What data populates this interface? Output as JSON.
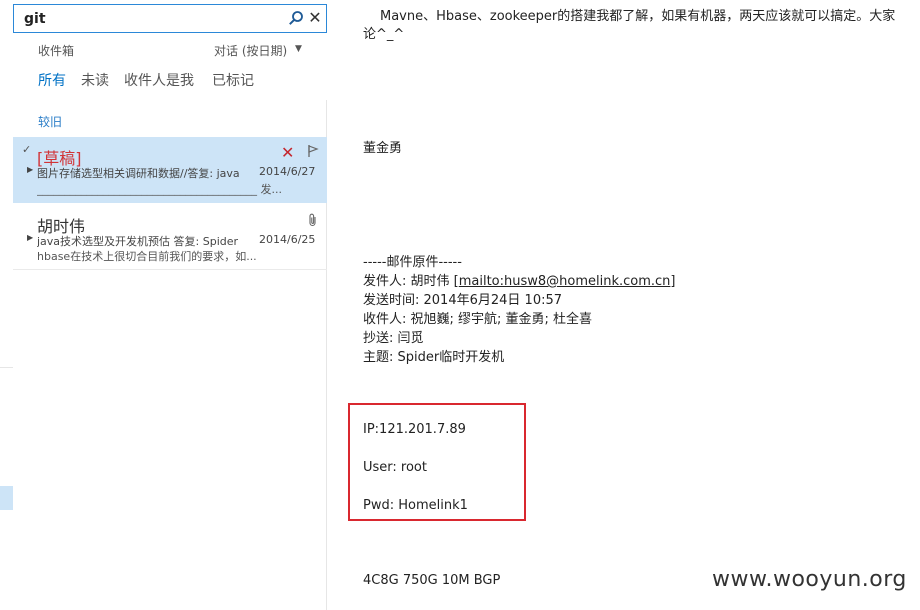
{
  "search": {
    "value": "git"
  },
  "folder": {
    "label": "收件箱",
    "sort": "对话 (按日期)"
  },
  "filters": [
    {
      "label": "所有"
    },
    {
      "label": "未读"
    },
    {
      "label": "收件人是我"
    },
    {
      "label": "已标记"
    }
  ],
  "group": {
    "label": "较旧"
  },
  "messages": [
    {
      "sender": "[草稿]",
      "subject": "图片存储选型相关调研和数据//答复: java",
      "date": "2014/6/27",
      "preview": "________________________________________ 发..."
    },
    {
      "sender": "胡时伟",
      "subject": "java技术选型及开发机预估 答复: Spider",
      "date": "2014/6/25",
      "preview": "hbase在技术上很切合目前我们的要求，如..."
    }
  ],
  "reading": {
    "body_line1": "Mavne、Hbase、zookeeper的搭建我都了解，如果有机器，两天应该就可以搞定。大家",
    "body_line2": "论^_^",
    "signature": "董金勇",
    "original_header": "-----邮件原件-----",
    "from_prefix": "发件人: 胡时伟 [",
    "from_email": "mailto:husw8@homelink.com.cn",
    "from_suffix": "]",
    "sent": "发送时间: 2014年6月24日 10:57",
    "to": "收件人: 祝旭巍; 缪宇航; 董金勇; 杜全喜",
    "cc": "抄送: 闫觅",
    "subject": "主题: Spider临时开发机",
    "ip": "IP:121.201.7.89",
    "user": "User: root",
    "pwd": "Pwd: Homelink1",
    "spec": "4C8G 750G 10M BGP"
  },
  "watermark": "www.wooyun.org",
  "colors": {
    "accent": "#0072c6",
    "selected_bg": "#cde4f7",
    "draft_red": "#d13438",
    "highlight_box": "#d9282f"
  }
}
